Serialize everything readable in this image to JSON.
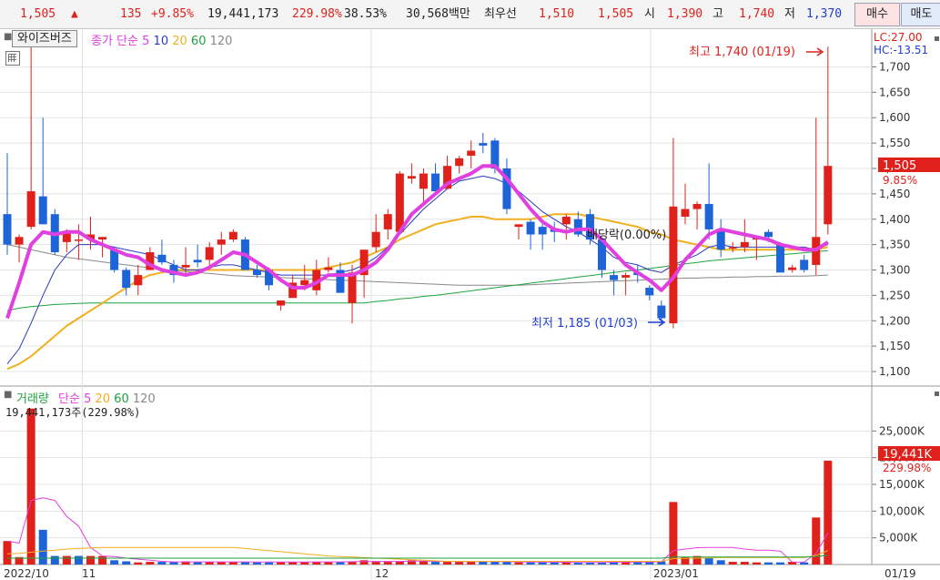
{
  "quote_bar": {
    "price": "1,505",
    "arrow": "▲",
    "change": "135",
    "change_pct": "+9.85%",
    "volume": "19,441,173",
    "volume_ratio": "229.98%",
    "turnover": "38.53%",
    "amount": "30,568백만",
    "best_ask_label": "최우선",
    "best_ask": "1,510",
    "best_bid": "1,505",
    "open_label": "시",
    "open": "1,390",
    "high_label": "고",
    "high": "1,740",
    "low_label": "저",
    "low": "1,370",
    "buy_button": "매수",
    "sell_button": "매도"
  },
  "price_panel": {
    "stock_name": "와이즈버즈",
    "legend_title": "종가 단순",
    "ma_periods": [
      "5",
      "10",
      "20",
      "60",
      "120"
    ],
    "lc_label": "LC:27.00",
    "hc_label": "HC:-13.51",
    "max_annotation": "최고 1,740 (01/19)",
    "min_annotation": "최저 1,185 (01/03)",
    "ex_rights_annotation": "배당락(0.00%)",
    "current_price_tag": "1,505",
    "current_pct_tag": "9.85%"
  },
  "volume_panel": {
    "legend_title": "거래량",
    "legend_ma": "단순",
    "ma_periods": [
      "5",
      "20",
      "60",
      "120"
    ],
    "info": "19,441,173주(229.98%)",
    "current_tag": "19,441K",
    "current_pct_tag": "229.98%"
  },
  "x_axis_labels": [
    "2022/10",
    "11",
    "12",
    "2023/01",
    "01/19"
  ],
  "colors": {
    "up": "#e0211b",
    "down": "#1d64d9",
    "ma5": "#e040e0",
    "ma10": "#2a3bbf",
    "ma20": "#f0b020",
    "ma60": "#1ea33c",
    "ma120": "#888888"
  },
  "chart_data": [
    {
      "type": "candlestick",
      "title": "",
      "xlabel": "",
      "ylabel": "",
      "ylim": [
        1075,
        1760
      ],
      "y_ticks": [
        1100,
        1150,
        1200,
        1250,
        1300,
        1350,
        1400,
        1450,
        1500,
        1550,
        1600,
        1650,
        1700
      ],
      "candles": [
        {
          "o": 1410,
          "h": 1530,
          "l": 1330,
          "c": 1350
        },
        {
          "o": 1350,
          "h": 1370,
          "l": 1315,
          "c": 1365
        },
        {
          "o": 1385,
          "h": 1740,
          "l": 1380,
          "c": 1455
        },
        {
          "o": 1445,
          "h": 1600,
          "l": 1400,
          "c": 1390
        },
        {
          "o": 1410,
          "h": 1420,
          "l": 1330,
          "c": 1335
        },
        {
          "o": 1355,
          "h": 1380,
          "l": 1335,
          "c": 1375
        },
        {
          "o": 1360,
          "h": 1390,
          "l": 1320,
          "c": 1360
        },
        {
          "o": 1360,
          "h": 1405,
          "l": 1340,
          "c": 1370
        },
        {
          "o": 1360,
          "h": 1365,
          "l": 1325,
          "c": 1365
        },
        {
          "o": 1340,
          "h": 1345,
          "l": 1295,
          "c": 1300
        },
        {
          "o": 1300,
          "h": 1305,
          "l": 1250,
          "c": 1265
        },
        {
          "o": 1270,
          "h": 1310,
          "l": 1250,
          "c": 1290
        },
        {
          "o": 1300,
          "h": 1345,
          "l": 1300,
          "c": 1335
        },
        {
          "o": 1330,
          "h": 1360,
          "l": 1310,
          "c": 1315
        },
        {
          "o": 1310,
          "h": 1320,
          "l": 1275,
          "c": 1290
        },
        {
          "o": 1305,
          "h": 1345,
          "l": 1290,
          "c": 1310
        },
        {
          "o": 1320,
          "h": 1350,
          "l": 1305,
          "c": 1315
        },
        {
          "o": 1320,
          "h": 1355,
          "l": 1305,
          "c": 1345
        },
        {
          "o": 1350,
          "h": 1375,
          "l": 1330,
          "c": 1360
        },
        {
          "o": 1360,
          "h": 1380,
          "l": 1355,
          "c": 1375
        },
        {
          "o": 1360,
          "h": 1365,
          "l": 1300,
          "c": 1300
        },
        {
          "o": 1300,
          "h": 1310,
          "l": 1285,
          "c": 1290
        },
        {
          "o": 1300,
          "h": 1305,
          "l": 1260,
          "c": 1270
        },
        {
          "o": 1230,
          "h": 1240,
          "l": 1220,
          "c": 1240
        },
        {
          "o": 1245,
          "h": 1290,
          "l": 1245,
          "c": 1275
        },
        {
          "o": 1270,
          "h": 1310,
          "l": 1260,
          "c": 1280
        },
        {
          "o": 1260,
          "h": 1320,
          "l": 1250,
          "c": 1300
        },
        {
          "o": 1300,
          "h": 1325,
          "l": 1295,
          "c": 1305
        },
        {
          "o": 1300,
          "h": 1315,
          "l": 1255,
          "c": 1255
        },
        {
          "o": 1235,
          "h": 1310,
          "l": 1195,
          "c": 1295
        },
        {
          "o": 1290,
          "h": 1320,
          "l": 1245,
          "c": 1340
        },
        {
          "o": 1345,
          "h": 1410,
          "l": 1335,
          "c": 1375
        },
        {
          "o": 1380,
          "h": 1420,
          "l": 1360,
          "c": 1410
        },
        {
          "o": 1375,
          "h": 1495,
          "l": 1370,
          "c": 1490
        },
        {
          "o": 1480,
          "h": 1510,
          "l": 1470,
          "c": 1485
        },
        {
          "o": 1460,
          "h": 1500,
          "l": 1430,
          "c": 1490
        },
        {
          "o": 1490,
          "h": 1510,
          "l": 1455,
          "c": 1455
        },
        {
          "o": 1460,
          "h": 1525,
          "l": 1460,
          "c": 1505
        },
        {
          "o": 1505,
          "h": 1525,
          "l": 1490,
          "c": 1520
        },
        {
          "o": 1525,
          "h": 1555,
          "l": 1500,
          "c": 1535
        },
        {
          "o": 1550,
          "h": 1570,
          "l": 1530,
          "c": 1545
        },
        {
          "o": 1555,
          "h": 1560,
          "l": 1490,
          "c": 1500
        },
        {
          "o": 1500,
          "h": 1520,
          "l": 1410,
          "c": 1420
        },
        {
          "o": 1385,
          "h": 1390,
          "l": 1360,
          "c": 1390
        },
        {
          "o": 1395,
          "h": 1400,
          "l": 1340,
          "c": 1370
        },
        {
          "o": 1385,
          "h": 1395,
          "l": 1340,
          "c": 1370
        },
        {
          "o": 1380,
          "h": 1395,
          "l": 1355,
          "c": 1375
        },
        {
          "o": 1390,
          "h": 1410,
          "l": 1360,
          "c": 1405
        },
        {
          "o": 1400,
          "h": 1415,
          "l": 1365,
          "c": 1370
        },
        {
          "o": 1410,
          "h": 1420,
          "l": 1350,
          "c": 1360
        },
        {
          "o": 1360,
          "h": 1365,
          "l": 1285,
          "c": 1300
        },
        {
          "o": 1290,
          "h": 1300,
          "l": 1250,
          "c": 1280
        },
        {
          "o": 1285,
          "h": 1295,
          "l": 1250,
          "c": 1290
        },
        {
          "o": 1295,
          "h": 1310,
          "l": 1275,
          "c": 1290
        },
        {
          "o": 1265,
          "h": 1270,
          "l": 1240,
          "c": 1250
        },
        {
          "o": 1230,
          "h": 1240,
          "l": 1195,
          "c": 1205
        },
        {
          "o": 1195,
          "h": 1560,
          "l": 1185,
          "c": 1425
        },
        {
          "o": 1405,
          "h": 1470,
          "l": 1390,
          "c": 1420
        },
        {
          "o": 1420,
          "h": 1435,
          "l": 1380,
          "c": 1430
        },
        {
          "o": 1430,
          "h": 1510,
          "l": 1360,
          "c": 1380
        },
        {
          "o": 1380,
          "h": 1400,
          "l": 1325,
          "c": 1340
        },
        {
          "o": 1345,
          "h": 1355,
          "l": 1335,
          "c": 1345
        },
        {
          "o": 1345,
          "h": 1400,
          "l": 1335,
          "c": 1355
        },
        {
          "o": 1360,
          "h": 1365,
          "l": 1320,
          "c": 1365
        },
        {
          "o": 1375,
          "h": 1380,
          "l": 1355,
          "c": 1365
        },
        {
          "o": 1350,
          "h": 1355,
          "l": 1295,
          "c": 1295
        },
        {
          "o": 1300,
          "h": 1310,
          "l": 1295,
          "c": 1305
        },
        {
          "o": 1320,
          "h": 1330,
          "l": 1295,
          "c": 1300
        },
        {
          "o": 1310,
          "h": 1600,
          "l": 1290,
          "c": 1365
        },
        {
          "o": 1390,
          "h": 1740,
          "l": 1370,
          "c": 1505
        }
      ],
      "ma5": [
        1205,
        1275,
        1350,
        1375,
        1370,
        1375,
        1375,
        1360,
        1350,
        1340,
        1330,
        1325,
        1310,
        1300,
        1295,
        1290,
        1295,
        1305,
        1320,
        1335,
        1330,
        1315,
        1300,
        1280,
        1265,
        1265,
        1275,
        1290,
        1290,
        1290,
        1300,
        1315,
        1340,
        1375,
        1410,
        1430,
        1450,
        1470,
        1480,
        1490,
        1505,
        1505,
        1480,
        1450,
        1420,
        1395,
        1380,
        1375,
        1380,
        1380,
        1360,
        1335,
        1310,
        1295,
        1280,
        1260,
        1285,
        1320,
        1345,
        1370,
        1380,
        1375,
        1370,
        1365,
        1360,
        1350,
        1345,
        1340,
        1340,
        1355
      ],
      "ma10": [
        1115,
        1145,
        1195,
        1250,
        1300,
        1330,
        1350,
        1350,
        1350,
        1345,
        1340,
        1335,
        1330,
        1320,
        1310,
        1300,
        1300,
        1305,
        1310,
        1310,
        1305,
        1300,
        1295,
        1290,
        1290,
        1290,
        1290,
        1290,
        1295,
        1300,
        1310,
        1325,
        1345,
        1370,
        1395,
        1420,
        1440,
        1460,
        1475,
        1480,
        1485,
        1480,
        1470,
        1455,
        1435,
        1415,
        1400,
        1385,
        1375,
        1360,
        1345,
        1325,
        1315,
        1310,
        1300,
        1295,
        1310,
        1320,
        1330,
        1345,
        1350,
        1345,
        1345,
        1345,
        1345,
        1345,
        1345,
        1345,
        1340,
        1350
      ],
      "ma20": [
        1105,
        1115,
        1130,
        1150,
        1170,
        1190,
        1205,
        1220,
        1235,
        1250,
        1265,
        1280,
        1290,
        1295,
        1300,
        1300,
        1300,
        1300,
        1300,
        1300,
        1300,
        1300,
        1300,
        1300,
        1300,
        1300,
        1300,
        1305,
        1310,
        1315,
        1325,
        1335,
        1345,
        1360,
        1370,
        1380,
        1390,
        1395,
        1400,
        1405,
        1405,
        1400,
        1400,
        1400,
        1400,
        1405,
        1410,
        1410,
        1410,
        1405,
        1400,
        1395,
        1390,
        1385,
        1375,
        1370,
        1360,
        1355,
        1350,
        1345,
        1340,
        1340,
        1340,
        1340,
        1340,
        1340,
        1340,
        1340,
        1340,
        1345
      ],
      "ma60": [
        1220,
        1225,
        1228,
        1230,
        1232,
        1233,
        1234,
        1235,
        1235,
        1235,
        1235,
        1235,
        1235,
        1235,
        1235,
        1235,
        1235,
        1235,
        1235,
        1235,
        1235,
        1235,
        1235,
        1235,
        1235,
        1235,
        1235,
        1235,
        1235,
        1235,
        1235,
        1238,
        1240,
        1243,
        1245,
        1248,
        1250,
        1253,
        1256,
        1259,
        1262,
        1265,
        1268,
        1271,
        1274,
        1277,
        1280,
        1283,
        1286,
        1289,
        1292,
        1295,
        1298,
        1300,
        1303,
        1306,
        1309,
        1312,
        1315,
        1318,
        1320,
        1322,
        1324,
        1326,
        1328,
        1330,
        1332,
        1334,
        1336,
        1338
      ],
      "ma120": [
        1350,
        1345,
        1340,
        1335,
        1330,
        1325,
        1322,
        1319,
        1316,
        1313,
        1310,
        1307,
        1304,
        1301,
        1299,
        1297,
        1295,
        1293,
        1291,
        1289,
        1288,
        1287,
        1286,
        1285,
        1284,
        1283,
        1282,
        1281,
        1280,
        1279,
        1278,
        1277,
        1276,
        1275,
        1274,
        1273,
        1272,
        1271,
        1270,
        1270,
        1270,
        1270,
        1270,
        1270,
        1271,
        1272,
        1273,
        1274,
        1275,
        1276,
        1277,
        1278,
        1279,
        1280,
        1281,
        1282,
        1283,
        1284,
        1284,
        1285,
        1285,
        1286,
        1286,
        1287,
        1287,
        1288,
        1288,
        1288,
        1289,
        1290
      ]
    },
    {
      "type": "bar",
      "title": "",
      "xlabel": "",
      "ylabel": "",
      "ylim": [
        0,
        30000
      ],
      "y_tick_labels": [
        "5,000K",
        "10,000K",
        "15,000K",
        "20,000K",
        "25,000K"
      ],
      "y_ticks": [
        5000,
        10000,
        15000,
        20000,
        25000
      ],
      "values": [
        4400,
        1400,
        29200,
        6500,
        1600,
        1600,
        1600,
        1600,
        1600,
        800,
        600,
        400,
        500,
        500,
        500,
        600,
        500,
        500,
        500,
        500,
        500,
        400,
        400,
        500,
        500,
        500,
        500,
        500,
        500,
        600,
        800,
        500,
        500,
        600,
        800,
        600,
        500,
        500,
        500,
        500,
        600,
        500,
        500,
        400,
        400,
        400,
        400,
        400,
        400,
        400,
        400,
        500,
        500,
        500,
        500,
        600,
        11700,
        1400,
        1600,
        1200,
        800,
        500,
        500,
        400,
        400,
        400,
        500,
        400,
        8800,
        19441
      ],
      "up": [
        true,
        true,
        true,
        false,
        false,
        true,
        false,
        true,
        true,
        false,
        false,
        true,
        true,
        false,
        false,
        true,
        false,
        true,
        true,
        true,
        false,
        false,
        false,
        true,
        true,
        true,
        true,
        true,
        false,
        true,
        true,
        true,
        true,
        true,
        true,
        true,
        false,
        true,
        true,
        true,
        false,
        false,
        false,
        true,
        false,
        false,
        false,
        true,
        false,
        false,
        false,
        false,
        true,
        false,
        false,
        false,
        true,
        true,
        true,
        false,
        false,
        true,
        true,
        true,
        false,
        false,
        true,
        false,
        true,
        true
      ],
      "ma5_values": [
        4400,
        4000,
        12000,
        12500,
        12000,
        9000,
        7200,
        3200,
        1600,
        1500,
        1200,
        1000,
        800,
        600,
        500,
        500,
        500,
        500,
        500,
        500,
        500,
        480,
        460,
        460,
        460,
        480,
        500,
        500,
        500,
        520,
        560,
        580,
        580,
        580,
        640,
        640,
        600,
        580,
        560,
        540,
        560,
        540,
        520,
        500,
        480,
        460,
        440,
        420,
        400,
        400,
        400,
        420,
        440,
        460,
        480,
        520,
        2600,
        2900,
        3150,
        3200,
        3200,
        3200,
        2900,
        2700,
        2700,
        2500,
        460,
        440,
        2100,
        5900
      ],
      "ma20_values": [
        2000,
        2100,
        2300,
        2500,
        2700,
        2900,
        3000,
        3100,
        3200,
        3200,
        3200,
        3200,
        3200,
        3200,
        3200,
        3200,
        3200,
        3200,
        3200,
        3200,
        3000,
        2800,
        2600,
        2400,
        2200,
        2000,
        1800,
        1600,
        1500,
        1400,
        1300,
        1200,
        1100,
        1000,
        900,
        800,
        700,
        600,
        600,
        600,
        600,
        600,
        600,
        600,
        600,
        600,
        600,
        600,
        600,
        600,
        600,
        600,
        600,
        600,
        600,
        600,
        1100,
        1150,
        1200,
        1250,
        1300,
        1300,
        1300,
        1300,
        1300,
        1300,
        1300,
        1300,
        1700,
        2600
      ],
      "ma60_values": [
        1200,
        1200,
        1200,
        1200,
        1200,
        1200,
        1200,
        1200,
        1200,
        1200,
        1200,
        1200,
        1200,
        1200,
        1200,
        1200,
        1200,
        1200,
        1200,
        1200,
        1200,
        1200,
        1200,
        1200,
        1200,
        1200,
        1200,
        1200,
        1200,
        1200,
        1200,
        1200,
        1200,
        1200,
        1200,
        1200,
        1200,
        1200,
        1200,
        1200,
        1200,
        1200,
        1200,
        1200,
        1200,
        1200,
        1200,
        1200,
        1200,
        1200,
        1200,
        1200,
        1200,
        1200,
        1200,
        1200,
        1400,
        1400,
        1400,
        1400,
        1400,
        1400,
        1400,
        1400,
        1400,
        1400,
        1400,
        1400,
        1500,
        1700
      ]
    }
  ]
}
